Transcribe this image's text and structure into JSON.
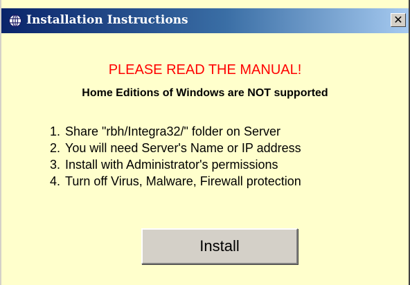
{
  "window": {
    "title": "Installation Instructions",
    "close_label": "✕",
    "app_icon": "globe-icon",
    "close_icon": "close-icon",
    "background_color": "#ffffcc",
    "title_gradient": [
      "#0a246a",
      "#a6caf0"
    ]
  },
  "content": {
    "heading": "PLEASE READ THE MANUAL!",
    "heading_color": "#ff0000",
    "subheading": "Home Editions of Windows are NOT supported",
    "steps": [
      {
        "num": "1.",
        "text": "Share \"rbh/Integra32/\" folder on Server"
      },
      {
        "num": "2.",
        "text": "You will need Server's Name or IP address"
      },
      {
        "num": "3.",
        "text": "Install with Administrator's permissions"
      },
      {
        "num": "4.",
        "text": "Turn off Virus, Malware, Firewall protection"
      }
    ]
  },
  "actions": {
    "install_label": "Install"
  }
}
